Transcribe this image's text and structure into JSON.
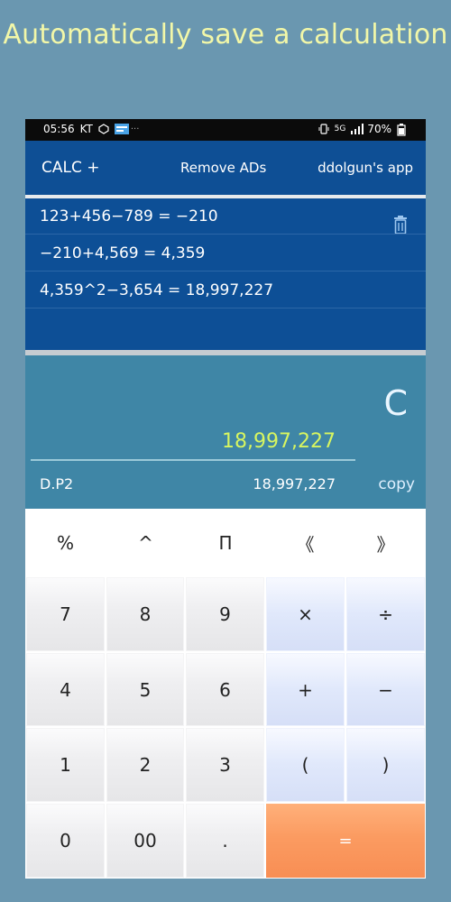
{
  "promo": {
    "text": "Automatically save a calculation"
  },
  "status_bar": {
    "time": "05:56",
    "carrier": "KT",
    "network": "5G",
    "battery": "70%"
  },
  "app_bar": {
    "title": "CALC +",
    "remove_ads": "Remove ADs",
    "developer": "ddolgun's app"
  },
  "history": [
    {
      "text": "123+456−789 = −210"
    },
    {
      "text": "−210+4,569 = 4,359"
    },
    {
      "text": "4,359^2−3,654 = 18,997,227"
    }
  ],
  "display": {
    "clear": "C",
    "result": "18,997,227",
    "mode": "D.P2",
    "result_small": "18,997,227",
    "copy": "copy"
  },
  "keypad": {
    "row1": [
      "%",
      "^",
      "Π",
      "《",
      "》"
    ],
    "row2": [
      "7",
      "8",
      "9",
      "×",
      "÷"
    ],
    "row3": [
      "4",
      "5",
      "6",
      "+",
      "−"
    ],
    "row4": [
      "1",
      "2",
      "3",
      "(",
      ")"
    ],
    "row5": [
      "0",
      "00",
      ".",
      "="
    ]
  },
  "colors": {
    "background": "#6a97b0",
    "promo_text": "#f2f7a8",
    "app_bar": "#0e4f95",
    "result_text": "#d7f560",
    "equals_key": "#fb9b61"
  }
}
